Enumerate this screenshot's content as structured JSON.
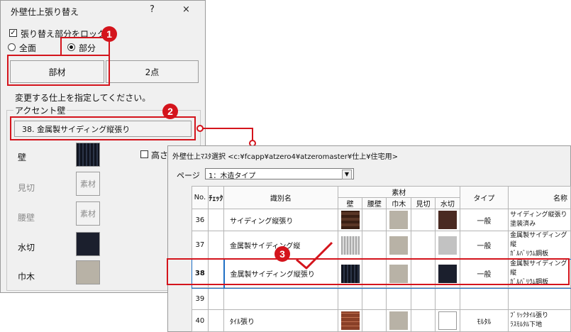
{
  "dialog": {
    "title": "外壁仕上張り替え",
    "help_btn": "?",
    "close_btn": "×",
    "lock_label": "張り替え部分をロック",
    "lock_checked": true,
    "radio_all": "全面",
    "radio_part": "部分",
    "selected_radio": "部分",
    "btn_member": "部材",
    "btn_2pt": "2点",
    "instruction": "変更する仕上を指定してください。",
    "group_label": "アクセント壁",
    "finish_button": "38. 金属製サイディング縦張り",
    "height_label": "高さ",
    "rows": [
      {
        "label": "壁",
        "enabled": true,
        "swatch": "#1c2233",
        "striped": true
      },
      {
        "label": "見切",
        "enabled": false,
        "button": "素材"
      },
      {
        "label": "腰壁",
        "enabled": false,
        "button": "素材"
      },
      {
        "label": "水切",
        "enabled": true,
        "swatch": "#1b1f2d"
      },
      {
        "label": "巾木",
        "enabled": true,
        "swatch": "#b8b2a6"
      }
    ]
  },
  "callouts": [
    "1",
    "2",
    "3"
  ],
  "master": {
    "title": "外壁仕上ﾏｽﾀ選択 <c:¥fcapp¥atzero4¥atzeromaster¥仕上¥住宅用>",
    "page_label": "ページ",
    "page_value": "1：木造タイプ",
    "headers": {
      "no": "No.",
      "check": "ﾁｪｯｸ",
      "name": "識別名",
      "material": "素材",
      "type": "タイプ",
      "fullname": "名称"
    },
    "sub_headers": [
      "壁",
      "腰壁",
      "巾木",
      "見切",
      "水切"
    ],
    "rows": [
      {
        "no": "36",
        "name": "サイディング縦張り",
        "type": "一般",
        "fn1": "サイディング縦張り",
        "fn2": "塗装済み",
        "wall": "#4a2a1c",
        "habaki": "#b8b2a6",
        "mizukiri": "#4a2a22"
      },
      {
        "no": "37",
        "name": "金属製サイディング縦",
        "type": "一般",
        "fn1": "金属製サイディング縦",
        "fn2": "ｶﾞﾙﾊﾞﾘｳﾑ鋼板",
        "wall": "#c9c9c9",
        "habaki": "#b8b2a6",
        "mizukiri": "#c2c2c2"
      },
      {
        "no": "38",
        "name": "金属製サイディング縦張り",
        "type": "一般",
        "fn1": "金属製サイディング縦",
        "fn2": "ｶﾞﾙﾊﾞﾘｳﾑ鋼板",
        "wall": "#1c2233",
        "habaki": "#b8b2a6",
        "mizukiri": "#1b1f2d"
      },
      {
        "no": "39",
        "name": "",
        "type": "",
        "fn1": "",
        "fn2": "",
        "wall": "",
        "habaki": "",
        "mizukiri": ""
      },
      {
        "no": "40",
        "name": "ﾀｲﾙ張り",
        "type": "ﾓﾙﾀﾙ",
        "fn1": "ﾌﾞﾘｯｸﾀｲﾙ張り",
        "fn2": "ﾗｽﾓﾙﾀﾙ下地",
        "wall": "#a0543a",
        "habaki": "#b8b2a6",
        "mizukiri": "#ffffff"
      }
    ]
  },
  "colors": {
    "accent": "#d4141c",
    "selection": "#1f6fc4"
  }
}
